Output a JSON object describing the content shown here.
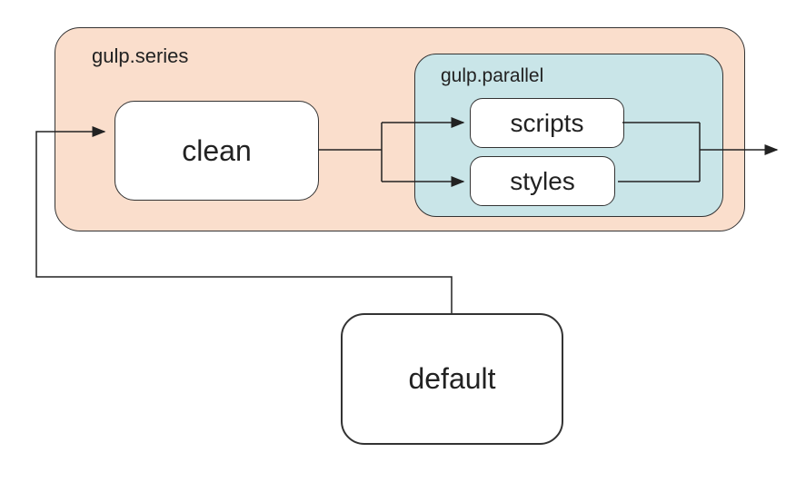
{
  "diagram": {
    "series_label": "gulp.series",
    "parallel_label": "gulp.parallel",
    "tasks": {
      "clean": "clean",
      "scripts": "scripts",
      "styles": "styles",
      "default": "default"
    }
  }
}
